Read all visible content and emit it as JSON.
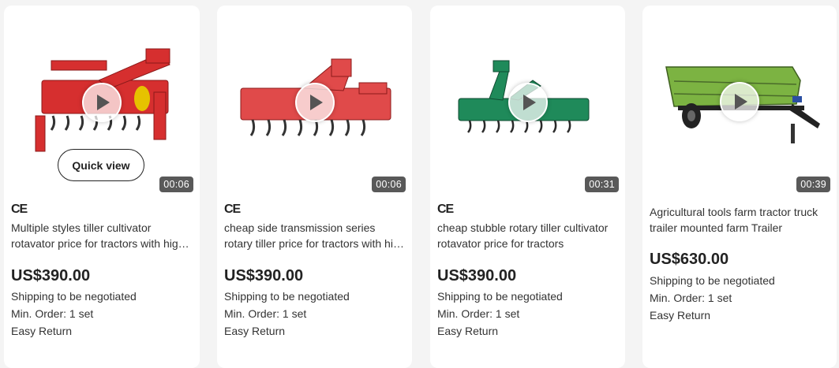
{
  "products": [
    {
      "duration": "00:06",
      "quick_view": "Quick view",
      "cert": "CE",
      "title": "Multiple styles tiller cultivator rotavator price for tractors with high quality",
      "price": "US$390.00",
      "shipping": "Shipping to be negotiated",
      "min_order": "Min. Order: 1 set",
      "returns": "Easy Return",
      "image_color": "#d62f2f"
    },
    {
      "duration": "00:06",
      "cert": "CE",
      "title": "cheap side transmission series rotary tiller price for tractors with high quality",
      "price": "US$390.00",
      "shipping": "Shipping to be negotiated",
      "min_order": "Min. Order: 1 set",
      "returns": "Easy Return",
      "image_color": "#e04a4a"
    },
    {
      "duration": "00:31",
      "cert": "CE",
      "title": "cheap stubble rotary tiller cultivator rotavator price for tractors",
      "price": "US$390.00",
      "shipping": "Shipping to be negotiated",
      "min_order": "Min. Order: 1 set",
      "returns": "Easy Return",
      "image_color": "#1f8a5a"
    },
    {
      "duration": "00:39",
      "title": "Agricultural tools farm tractor truck trailer mounted farm Trailer",
      "price": "US$630.00",
      "shipping": "Shipping to be negotiated",
      "min_order": "Min. Order: 1 set",
      "returns": "Easy Return",
      "image_color": "#7cb342"
    }
  ]
}
